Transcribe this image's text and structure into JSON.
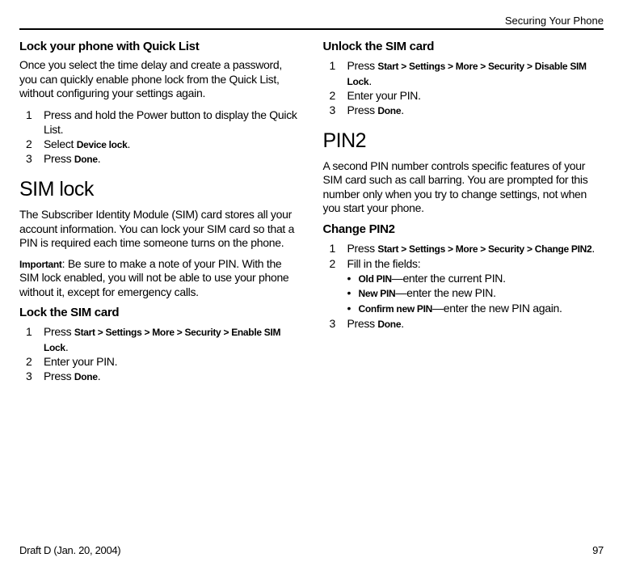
{
  "header": {
    "section": "Securing Your Phone"
  },
  "left": {
    "sec1": {
      "title": "Lock your phone with Quick List",
      "intro": "Once you select the time delay and create a password, you can quickly enable phone lock from the Quick List, without configuring your settings again.",
      "steps": [
        "Press and hold the Power button to display the Quick List.",
        [
          "Select ",
          "Device lock",
          "."
        ],
        [
          "Press ",
          "Done",
          "."
        ]
      ]
    },
    "sec2": {
      "title": "SIM lock",
      "p1": "The Subscriber Identity Module (SIM) card stores all your account information. You can lock your SIM card so that a PIN is required each time someone turns on the phone.",
      "p2_bold": "Important",
      "p2_rest": ": Be sure to make a note of your PIN. With the SIM lock enabled, you will not be able to use your phone without it, except for emergency calls."
    },
    "sec3": {
      "title": "Lock the SIM card",
      "steps": [
        [
          "Press ",
          "Start > Settings > More > Security > Enable SIM Lock",
          "."
        ],
        "Enter your PIN.",
        [
          "Press ",
          "Done",
          "."
        ]
      ]
    }
  },
  "right": {
    "sec1": {
      "title": "Unlock the SIM card",
      "steps": [
        [
          "Press ",
          "Start > Settings > More > Security > Disable SIM Lock",
          "."
        ],
        "Enter your PIN.",
        [
          "Press ",
          "Done",
          "."
        ]
      ]
    },
    "sec2": {
      "title": "PIN2",
      "p1": "A second PIN number controls specific features of your SIM card such as call barring. You are prompted for this number only when you try to change settings, not when you start your phone."
    },
    "sec3": {
      "title": "Change PIN2",
      "steps": [
        [
          "Press ",
          "Start > Settings > More > Security > Change PIN2",
          "."
        ],
        "Fill in the fields:",
        [
          "Press ",
          "Done",
          "."
        ]
      ],
      "bullets": [
        [
          "Old PIN",
          "—enter the current PIN."
        ],
        [
          "New PIN",
          "—enter the new PIN."
        ],
        [
          "Confirm new PIN",
          "—enter the new PIN again."
        ]
      ]
    }
  },
  "footer": {
    "left": "Draft D (Jan. 20, 2004)",
    "right": "97"
  }
}
